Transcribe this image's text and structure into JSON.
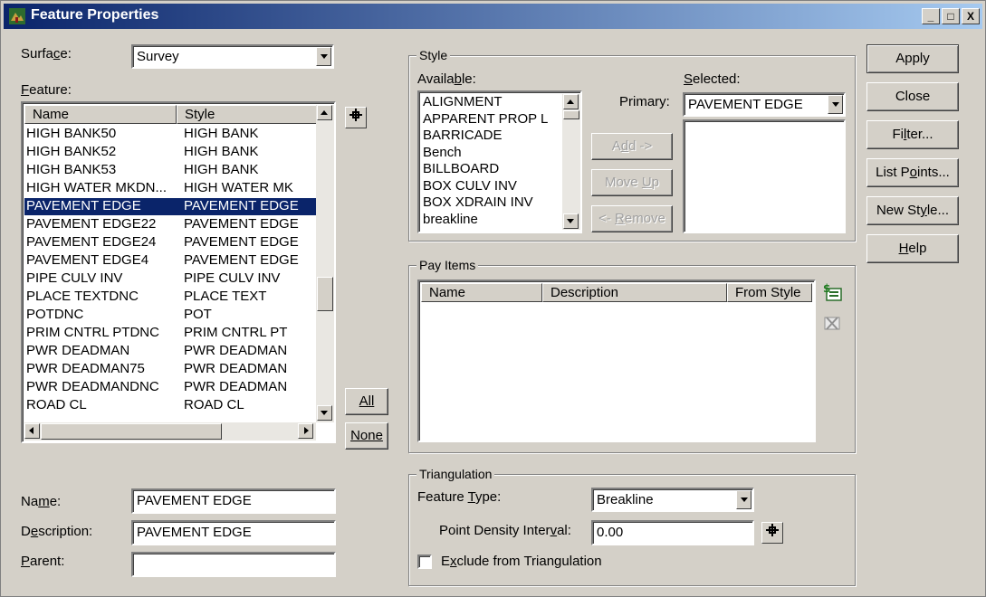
{
  "window": {
    "title": "Feature Properties",
    "minimize": "_",
    "maximize": "□",
    "close": "X"
  },
  "surface": {
    "label": "Surface:",
    "value": "Survey"
  },
  "feature": {
    "label": "Feature:",
    "columns": [
      "Name",
      "Style"
    ],
    "rows": [
      {
        "name": "HIGH BANK50",
        "style": "HIGH BANK"
      },
      {
        "name": "HIGH BANK52",
        "style": "HIGH BANK"
      },
      {
        "name": "HIGH BANK53",
        "style": "HIGH BANK"
      },
      {
        "name": "HIGH WATER MKDN...",
        "style": "HIGH WATER MK"
      },
      {
        "name": "PAVEMENT EDGE",
        "style": "PAVEMENT EDGE",
        "selected": true
      },
      {
        "name": "PAVEMENT EDGE22",
        "style": "PAVEMENT EDGE"
      },
      {
        "name": "PAVEMENT EDGE24",
        "style": "PAVEMENT EDGE"
      },
      {
        "name": "PAVEMENT EDGE4",
        "style": "PAVEMENT EDGE"
      },
      {
        "name": "PIPE CULV INV",
        "style": "PIPE CULV INV"
      },
      {
        "name": "PLACE TEXTDNC",
        "style": "PLACE TEXT"
      },
      {
        "name": "POTDNC",
        "style": "POT"
      },
      {
        "name": "PRIM CNTRL PTDNC",
        "style": "PRIM CNTRL PT"
      },
      {
        "name": "PWR DEADMAN",
        "style": "PWR DEADMAN"
      },
      {
        "name": "PWR DEADMAN75",
        "style": "PWR DEADMAN"
      },
      {
        "name": "PWR DEADMANDNC",
        "style": "PWR DEADMAN"
      },
      {
        "name": "ROAD CL",
        "style": "ROAD CL"
      }
    ],
    "all_button": "All",
    "none_button": "None"
  },
  "name_field": {
    "label": "Name:",
    "value": "PAVEMENT EDGE"
  },
  "description_field": {
    "label": "Description:",
    "value": "PAVEMENT EDGE"
  },
  "parent_field": {
    "label": "Parent:",
    "value": ""
  },
  "style": {
    "group_title": "Style",
    "available_label": "Available:",
    "available_items": [
      "ALIGNMENT",
      "APPARENT PROP L",
      "BARRICADE",
      "Bench",
      "BILLBOARD",
      "BOX CULV INV",
      "BOX XDRAIN INV",
      "breakline"
    ],
    "selected_label": "Selected:",
    "primary_label": "Primary:",
    "primary_value": "PAVEMENT EDGE",
    "add_button": "Add ->",
    "move_up_button": "Move Up",
    "remove_button": "<- Remove"
  },
  "pay_items": {
    "group_title": "Pay Items",
    "columns": [
      "Name",
      "Description",
      "From Style"
    ]
  },
  "triangulation": {
    "group_title": "Triangulation",
    "feature_type_label": "Feature Type:",
    "feature_type_value": "Breakline",
    "point_density_label": "Point Density Interval:",
    "point_density_value": "0.00",
    "exclude_label": "Exclude from Triangulation",
    "exclude_checked": false
  },
  "actions": {
    "apply": "Apply",
    "close": "Close",
    "filter": "Filter...",
    "list_points": "List Points...",
    "new_style": "New Style...",
    "help": "Help"
  },
  "icons": {
    "pin": "pin-icon",
    "add_pay_item": "add-pay-item-icon",
    "delete_pay_item": "delete-pay-item-icon"
  }
}
